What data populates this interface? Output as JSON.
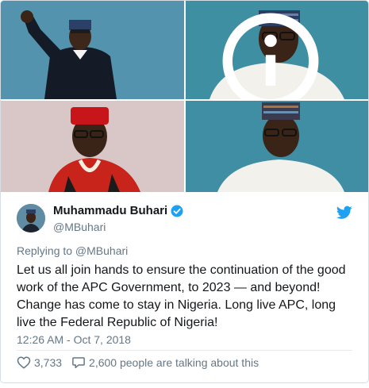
{
  "tweet": {
    "display_name": "Muhammadu Buhari",
    "handle": "@MBuhari",
    "reply_to": "Replying to @MBuhari",
    "text": "Let us all join hands to ensure the continuation of the good work of the APC Government, to 2023 — and beyond! Change has come to stay in Nigeria. Long live APC, long live the Federal Republic of Nigeria!",
    "timestamp": "12:26 AM - Oct 7, 2018",
    "likes": "3,733",
    "talking": "2,600 people are talking about this"
  },
  "icons": [
    "info-icon",
    "verified-badge-icon",
    "twitter-bird-icon",
    "heart-icon",
    "comment-icon"
  ],
  "colors": {
    "twitter_blue": "#1da1f2",
    "text": "#14171a",
    "muted": "#657786",
    "border": "#e1e8ed"
  }
}
